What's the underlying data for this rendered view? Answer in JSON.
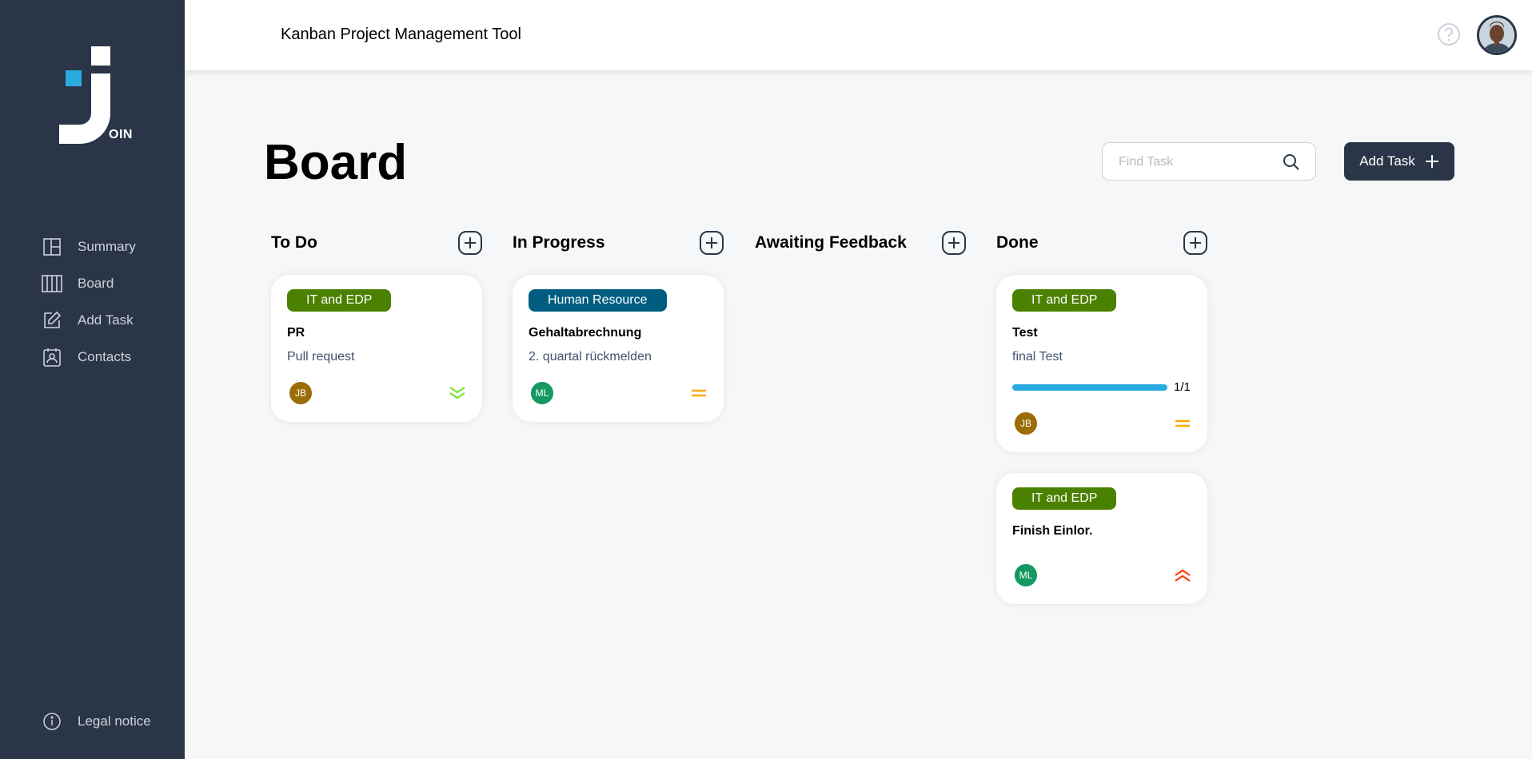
{
  "app": {
    "logo_text": "OIN"
  },
  "header": {
    "title": "Kanban Project Management Tool"
  },
  "sidebar": {
    "items": [
      {
        "label": "Summary",
        "icon": "summary-icon"
      },
      {
        "label": "Board",
        "icon": "board-icon"
      },
      {
        "label": "Add Task",
        "icon": "add-task-icon"
      },
      {
        "label": "Contacts",
        "icon": "contacts-icon"
      }
    ],
    "legal": "Legal notice"
  },
  "main": {
    "title": "Board",
    "search_placeholder": "Find Task",
    "add_task_label": "Add Task"
  },
  "columns": [
    {
      "title": "To Do"
    },
    {
      "title": "In Progress"
    },
    {
      "title": "Awaiting Feedback"
    },
    {
      "title": "Done"
    }
  ],
  "cards": {
    "todo_1": {
      "category": "IT and EDP",
      "title": "PR",
      "description": "Pull request",
      "user": "JB",
      "priority": "low"
    },
    "progress_1": {
      "category": "Human Resource",
      "title": "Gehaltabrechnung",
      "description": "2. quartal rückmelden",
      "user": "ML",
      "priority": "medium"
    },
    "done_1": {
      "category": "IT and EDP",
      "title": "Test",
      "description": "final Test",
      "subtasks_done": 1,
      "subtasks_total": 1,
      "progress_label": "1/1",
      "user": "JB",
      "priority": "medium"
    },
    "done_2": {
      "category": "IT and EDP",
      "title": "Finish Einlor.",
      "user": "ML",
      "priority": "urgent"
    }
  },
  "colors": {
    "sidebar": "#2a3647",
    "it_edp": "#4b8100",
    "human_resource": "#005d80",
    "user_jb": "#9c6c06",
    "user_ml": "#149961",
    "prio_low": "#7ae229",
    "prio_medium": "#ffa800",
    "prio_urgent": "#ff3d00",
    "progress": "#29abe2",
    "logo_accent": "#29abe2"
  }
}
